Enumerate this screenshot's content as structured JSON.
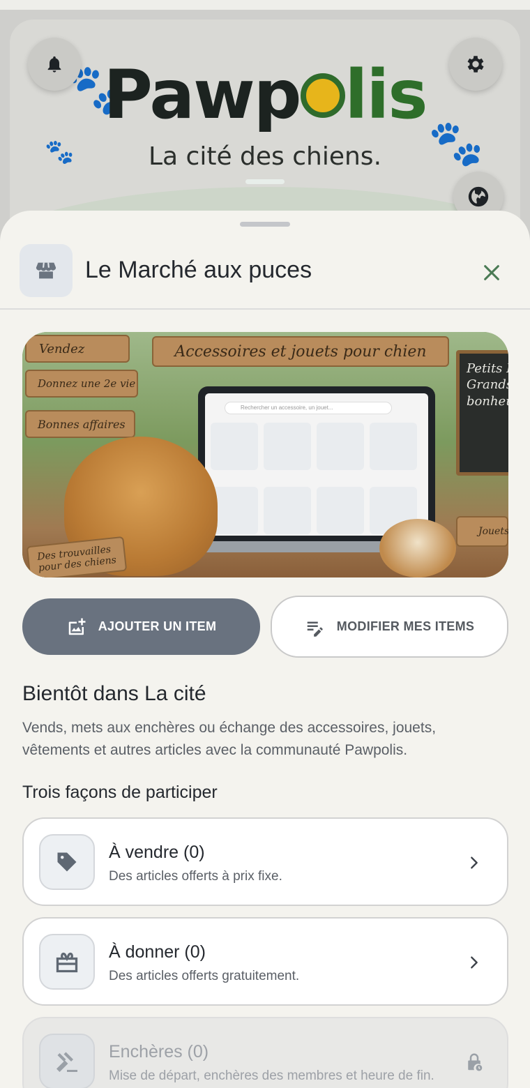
{
  "background": {
    "brand": "Pawpolis",
    "brand_parts": [
      "Pawp",
      "lis"
    ],
    "tagline": "La cité des chiens.",
    "icons": [
      "bell-icon",
      "gear-icon",
      "globe-icon"
    ]
  },
  "sheet": {
    "title": "Le Marché aux puces",
    "close_icon": "close-icon",
    "hero": {
      "banner": "Accessoires et jouets pour chien",
      "signs": [
        "Vendez",
        "Donnez une 2e vie",
        "Bonnes affaires"
      ],
      "bottom_sign": "Des trouvailles pour des chiens",
      "chalkboard": "Petits P Grands bonheur",
      "crate_label": "Jouets",
      "search_placeholder": "Rechercher un accessoire, un jouet..."
    },
    "actions": {
      "add_label": "AJOUTER UN ITEM",
      "edit_label": "MODIFIER MES ITEMS"
    },
    "coming_title": "Bientôt dans La cité",
    "coming_desc": "Vends, mets aux enchères ou échange des accessoires, jouets, vêtements et autres articles avec la communauté Pawpolis.",
    "ways_title": "Trois façons de participer",
    "options": [
      {
        "title": "À vendre (0)",
        "subtitle": "Des articles offerts à prix fixe.",
        "icon": "tag-icon",
        "locked": false
      },
      {
        "title": "À donner (0)",
        "subtitle": "Des articles offerts gratuitement.",
        "icon": "gift-icon",
        "locked": false
      },
      {
        "title": "Enchères (0)",
        "subtitle": "Mise de départ, enchères des membres et heure de fin.",
        "icon": "gavel-icon",
        "locked": true
      }
    ]
  },
  "colors": {
    "primary_button": "#69727f",
    "brand_green": "#2e6e2a",
    "brand_dark": "#1c2320",
    "sheet_bg": "#f4f3ee"
  }
}
